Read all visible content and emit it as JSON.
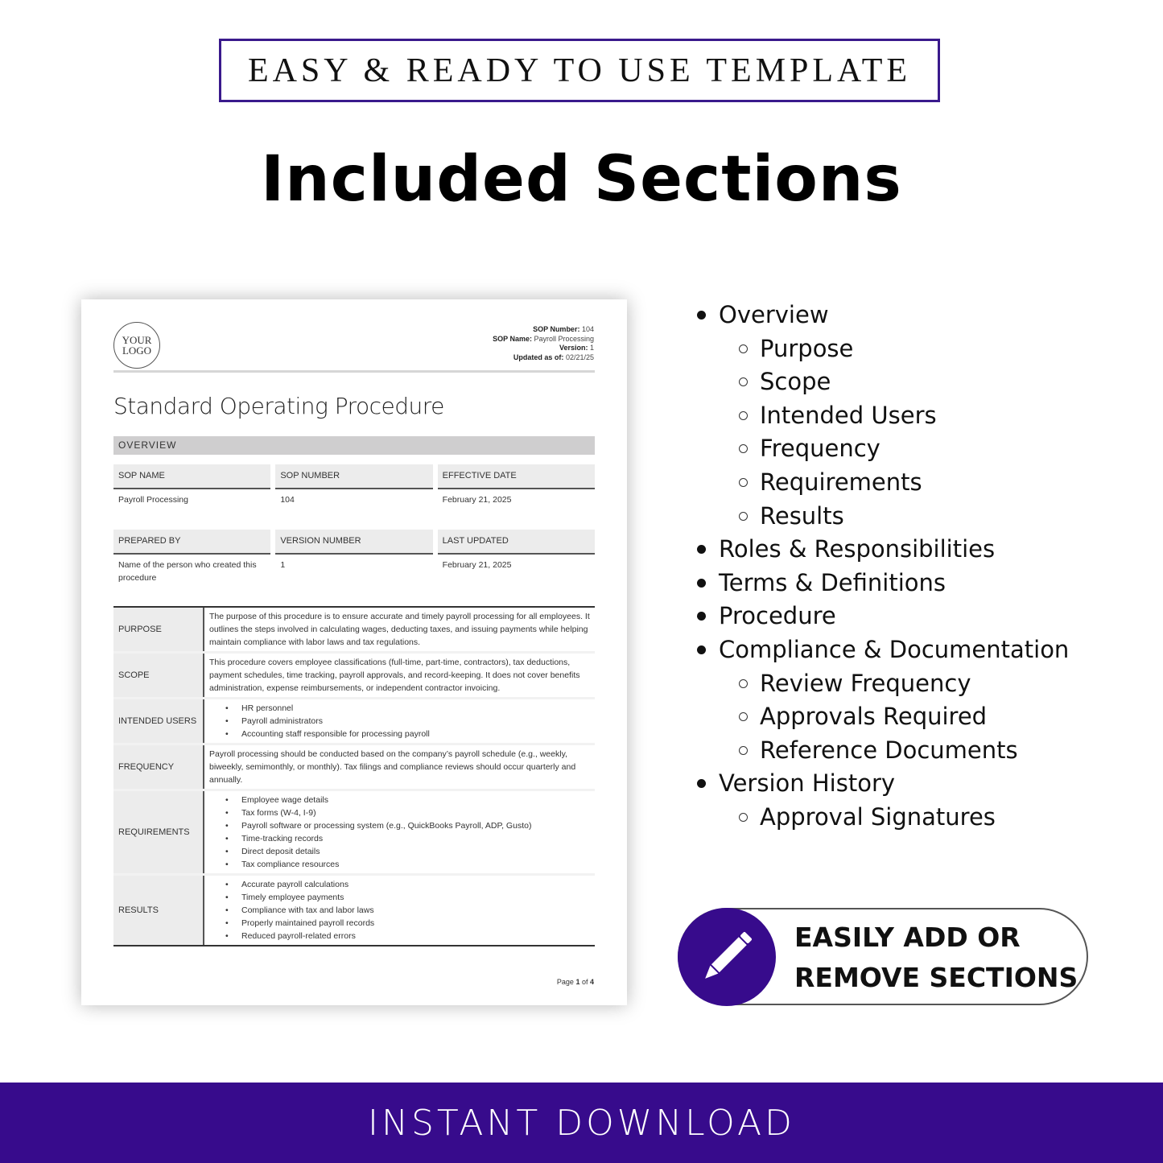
{
  "banner": "EASY & READY TO USE TEMPLATE",
  "title": "Included Sections",
  "document": {
    "logo": "YOUR\nLOGO",
    "meta": [
      {
        "label": "SOP Number:",
        "value": "104"
      },
      {
        "label": "SOP Name:",
        "value": "Payroll Processing"
      },
      {
        "label": "Version:",
        "value": "1"
      },
      {
        "label": "Updated as of:",
        "value": "02/21/25"
      }
    ],
    "heading": "Standard Operating Procedure",
    "section_bar": "OVERVIEW",
    "grid1": [
      {
        "header": "SOP NAME",
        "value": "Payroll Processing"
      },
      {
        "header": "SOP NUMBER",
        "value": "104"
      },
      {
        "header": "EFFECTIVE DATE",
        "value": "February 21, 2025"
      }
    ],
    "grid2": [
      {
        "header": "PREPARED BY",
        "value": "Name of the person who created this procedure"
      },
      {
        "header": "VERSION NUMBER",
        "value": "1"
      },
      {
        "header": "LAST UPDATED",
        "value": "February 21, 2025"
      }
    ],
    "rows": [
      {
        "label": "PURPOSE",
        "text": "The purpose of this procedure is to ensure accurate and timely payroll processing for all employees. It outlines the steps involved in calculating wages, deducting taxes, and issuing payments while helping maintain compliance with labor laws and tax regulations."
      },
      {
        "label": "SCOPE",
        "text": "This procedure covers employee classifications (full-time, part-time, contractors), tax deductions, payment schedules, time tracking, payroll approvals, and record-keeping. It does not cover benefits administration, expense reimbursements, or independent contractor invoicing."
      },
      {
        "label": "INTENDED USERS",
        "items": [
          "HR personnel",
          "Payroll administrators",
          "Accounting staff responsible for processing payroll"
        ]
      },
      {
        "label": "FREQUENCY",
        "text": "Payroll processing should be conducted based on the company’s payroll schedule (e.g., weekly, biweekly, semimonthly, or monthly). Tax filings and compliance reviews should occur quarterly and annually."
      },
      {
        "label": "REQUIREMENTS",
        "items": [
          "Employee wage details",
          "Tax forms (W-4, I-9)",
          "Payroll software or processing system (e.g., QuickBooks Payroll, ADP, Gusto)",
          "Time-tracking records",
          "Direct deposit details",
          "Tax compliance resources"
        ]
      },
      {
        "label": "RESULTS",
        "items": [
          "Accurate payroll calculations",
          "Timely employee payments",
          "Compliance with tax and labor laws",
          "Properly maintained payroll records",
          "Reduced payroll-related errors"
        ]
      }
    ],
    "page": "Page 1 of 4"
  },
  "sections": [
    {
      "label": "Overview",
      "level": 1
    },
    {
      "label": "Purpose",
      "level": 2
    },
    {
      "label": "Scope",
      "level": 2
    },
    {
      "label": "Intended Users",
      "level": 2
    },
    {
      "label": "Frequency",
      "level": 2
    },
    {
      "label": "Requirements",
      "level": 2
    },
    {
      "label": "Results",
      "level": 2
    },
    {
      "label": "Roles & Responsibilities",
      "level": 1
    },
    {
      "label": "Terms & Definitions",
      "level": 1
    },
    {
      "label": "Procedure",
      "level": 1
    },
    {
      "label": "Compliance & Documentation",
      "level": 1
    },
    {
      "label": "Review Frequency",
      "level": 2
    },
    {
      "label": "Approvals Required",
      "level": 2
    },
    {
      "label": "Reference Documents",
      "level": 2
    },
    {
      "label": "Version History",
      "level": 1
    },
    {
      "label": "Approval Signatures",
      "level": 2
    }
  ],
  "pill": {
    "icon": "pencil-icon",
    "line1": "EASILY ADD OR",
    "line2": "REMOVE SECTIONS"
  },
  "footer": "INSTANT DOWNLOAD",
  "colors": {
    "accent": "#370b8c",
    "border": "#3a1a8c"
  }
}
